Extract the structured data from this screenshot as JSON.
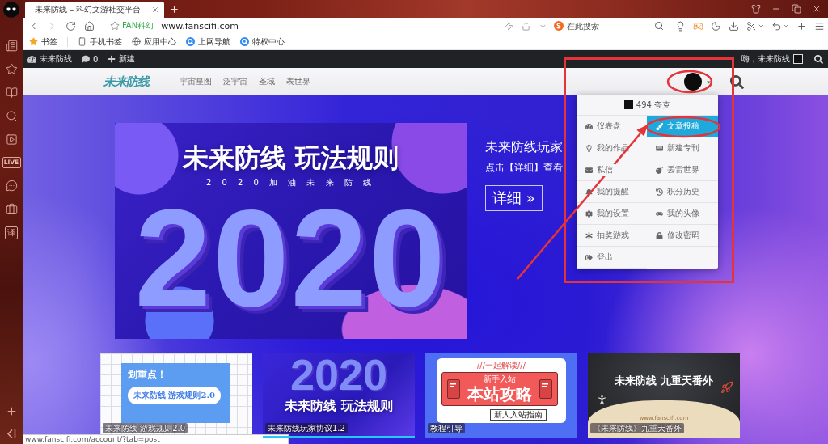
{
  "browser": {
    "tabs": [
      {
        "title": "未来防线 – 科幻文游社交平台",
        "selected": true
      }
    ],
    "site_badge": "FAN科幻",
    "url": "www.fanscifi.com",
    "search": {
      "placeholder": "在此搜索"
    },
    "bookmarks": [
      {
        "label": "书签"
      },
      {
        "label": "手机书签"
      },
      {
        "label": "应用中心"
      },
      {
        "label": "上网导航"
      },
      {
        "label": "特权中心"
      }
    ],
    "status_url": "www.fanscifi.com/account/?tab=post"
  },
  "sidebar": {
    "live_label": "LIVE",
    "translate_label": "译"
  },
  "admin_bar": {
    "site": "未来防线",
    "comments": "0",
    "new": "新建",
    "greeting": "嗨，未来防线"
  },
  "site_header": {
    "logo": "未来防线",
    "nav": [
      {
        "label": "宇宙星图"
      },
      {
        "label": "泛宇宙"
      },
      {
        "label": "圣域"
      },
      {
        "label": "表世界"
      }
    ]
  },
  "hero": {
    "banner": {
      "year": "2020",
      "title": "未来防线 玩法规则",
      "subtitle": "2 0 2 0 加 油 未 来 防 线"
    },
    "heading": "未来防线玩家",
    "text": "点击【详细】查看",
    "button": "详细 »"
  },
  "user_menu": {
    "points": "494 夸克",
    "items": [
      {
        "label": "仪表盘",
        "selected": false
      },
      {
        "label": "文章投稿",
        "selected": true
      },
      {
        "label": "我的作品",
        "selected": false
      },
      {
        "label": "新建专刊",
        "selected": false
      },
      {
        "label": "私信",
        "selected": false
      },
      {
        "label": "丢雷世界",
        "selected": false
      },
      {
        "label": "我的提醒",
        "selected": false
      },
      {
        "label": "积分历史",
        "selected": false
      },
      {
        "label": "我的设置",
        "selected": false
      },
      {
        "label": "我的头像",
        "selected": false
      },
      {
        "label": "抽奖游戏",
        "selected": false
      },
      {
        "label": "修改密码",
        "selected": false
      },
      {
        "label": "登出",
        "selected": false
      }
    ]
  },
  "cards": [
    {
      "kind": "notice",
      "selected": false,
      "caption": "未来防线 游戏规则2.0",
      "heading": "划重点！",
      "text": "未来防线 游戏规则2.0"
    },
    {
      "kind": "banner",
      "selected": true,
      "caption": "未来防线玩家协议1.2",
      "year": "2020",
      "title": "未来防线 玩法规则"
    },
    {
      "kind": "guide",
      "selected": false,
      "caption": "教程引导",
      "kicker": "///一起解读///",
      "subtitle": "新手入站",
      "title": "本站攻略",
      "note": "新人入站指南"
    },
    {
      "kind": "story",
      "selected": false,
      "caption": "《未来防线》九重天番外",
      "title": "未来防线 九重天番外",
      "url": "www.fanscifi.com"
    }
  ]
}
